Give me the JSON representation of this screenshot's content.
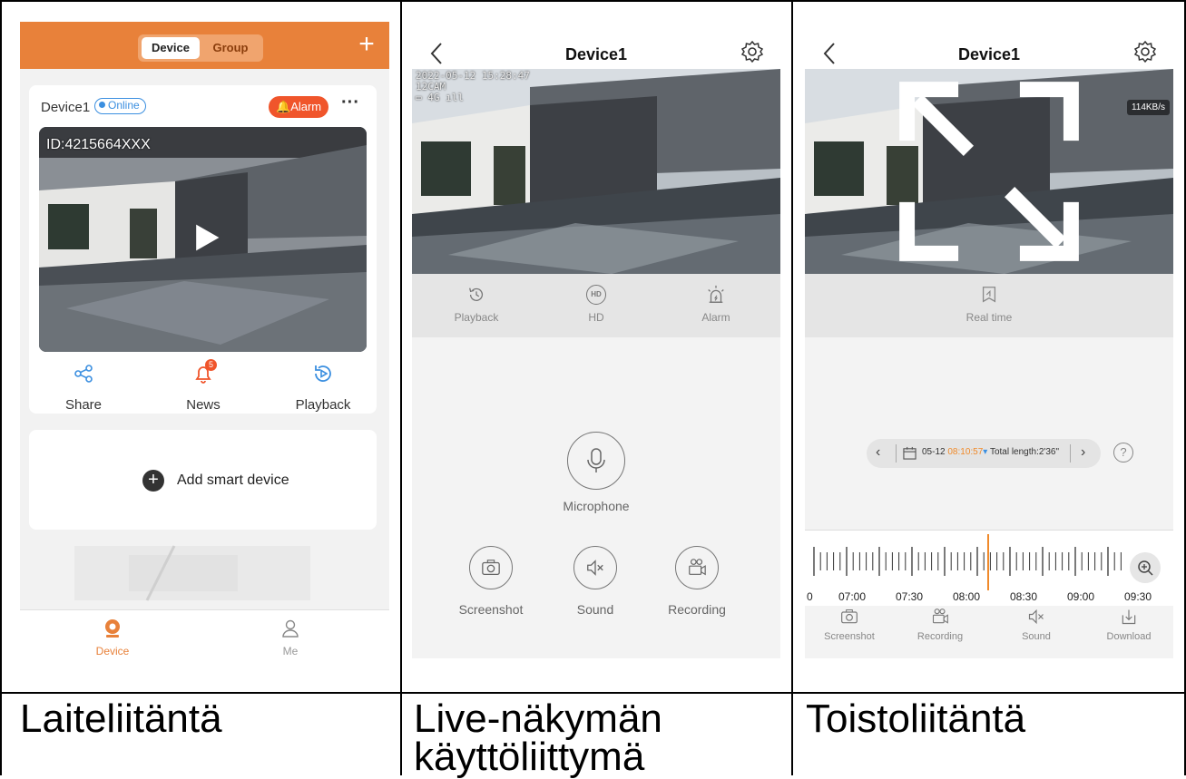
{
  "captions": {
    "device_ui": "Laiteliitäntä",
    "live_ui_line1": "Live-näkymän",
    "live_ui_line2": "käyttöliittymä",
    "playback_ui": "Toistoliitäntä"
  },
  "colors": {
    "brand_orange": "#e8813a",
    "online_blue": "#3b8fe0",
    "alarm_red": "#f0552b",
    "timeline_marker": "#f08a2a"
  },
  "device_screen": {
    "segments": [
      "Device",
      "Group"
    ],
    "active_segment": "Device",
    "device_name": "Device1",
    "status": "Online",
    "alarm_label": "Alarm",
    "more_label": "···",
    "device_id": "ID:4215664XXX",
    "actions": [
      {
        "label": "Share",
        "icon": "share-icon"
      },
      {
        "label": "News",
        "icon": "bell-icon",
        "badge": "5"
      },
      {
        "label": "Playback",
        "icon": "playback-icon"
      }
    ],
    "add_device_label": "Add smart device",
    "tabs": [
      {
        "label": "Device",
        "icon": "camera-icon",
        "active": true
      },
      {
        "label": "Me",
        "icon": "person-icon",
        "active": false
      }
    ]
  },
  "live_screen": {
    "title": "Device1",
    "osd_time": "2022-05-12 15:28:47",
    "osd_cam": "12CAM",
    "osd_net": "4G",
    "controls": [
      "Playback",
      "HD",
      "Alarm"
    ],
    "microphone_label": "Microphone",
    "bottom_buttons": [
      "Screenshot",
      "Sound",
      "Recording"
    ]
  },
  "playback_screen": {
    "title": "Device1",
    "bitrate": "114KB/s",
    "realtime_label": "Real time",
    "date": "05-12",
    "time": "08:10:57",
    "total_length": "Total length:2'36\"",
    "timeline_labels": [
      "0",
      "07:00",
      "07:30",
      "08:00",
      "08:30",
      "09:00",
      "09:30"
    ],
    "bottom_buttons": [
      "Screenshot",
      "Recording",
      "Sound",
      "Download"
    ]
  }
}
